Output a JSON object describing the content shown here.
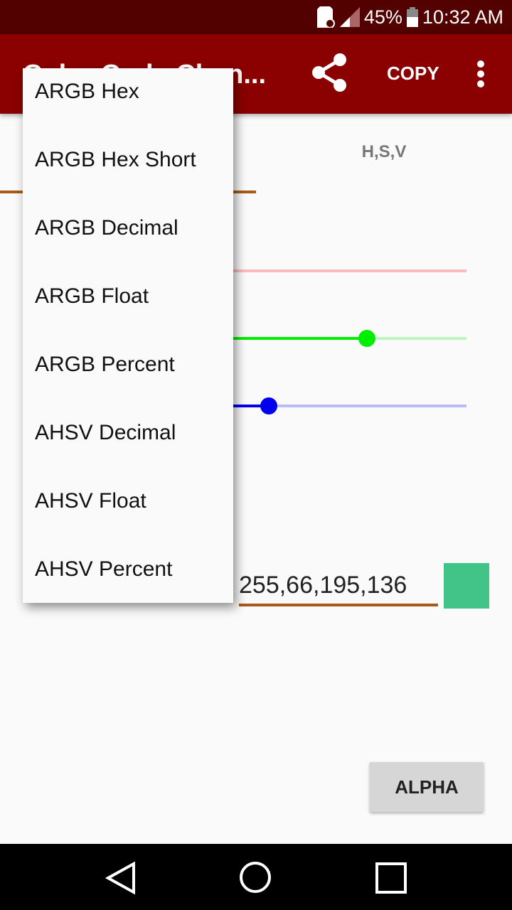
{
  "status_bar": {
    "battery": "45%",
    "time": "10:32 AM"
  },
  "app_bar": {
    "title": "Color Code Chan...",
    "copy_label": "COPY"
  },
  "tabs": [
    {
      "label": "H,S,V"
    }
  ],
  "sliders": {
    "max": 255,
    "red": {
      "value": 66,
      "color": "#ff0000"
    },
    "green": {
      "value": 195,
      "color": "#00ee00"
    },
    "blue": {
      "value": 136,
      "color": "#0000ee"
    }
  },
  "color_value": "255,66,195,136",
  "swatch_color": "#42c388",
  "alpha_label": "ALPHA",
  "menu": {
    "items": [
      "ARGB Hex",
      "ARGB Hex Short",
      "ARGB Decimal",
      "ARGB Float",
      "ARGB Percent",
      "AHSV Decimal",
      "AHSV Float",
      "AHSV Percent"
    ]
  },
  "colors": {
    "app_bar": "#8b0000",
    "status_bar": "#520000",
    "accent": "#a65b16"
  }
}
